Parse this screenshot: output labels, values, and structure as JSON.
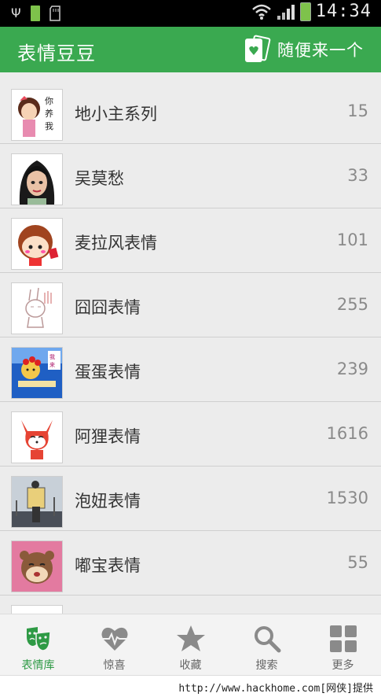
{
  "status_bar": {
    "time": "14:34",
    "icons": [
      "usb-icon",
      "battery-small-icon",
      "sd-card-icon",
      "wifi-icon",
      "signal-icon",
      "battery-icon"
    ]
  },
  "app_bar": {
    "title": "表情豆豆",
    "random_button_label": "随便来一个",
    "random_button_icon": "cards-heart-icon",
    "background_color": "#3aa950"
  },
  "list": {
    "items": [
      {
        "name": "地小主系列",
        "count": "15",
        "thumb": "cartoon-girl-thumb"
      },
      {
        "name": "吴莫愁",
        "count": "33",
        "thumb": "woman-portrait-thumb"
      },
      {
        "name": "麦拉风表情",
        "count": "101",
        "thumb": "round-girl-thumb"
      },
      {
        "name": "囧囧表情",
        "count": "255",
        "thumb": "rabbit-sketch-thumb"
      },
      {
        "name": "蛋蛋表情",
        "count": "239",
        "thumb": "egg-kid-thumb"
      },
      {
        "name": "阿狸表情",
        "count": "1616",
        "thumb": "ali-fox-thumb"
      },
      {
        "name": "泡妞表情",
        "count": "1530",
        "thumb": "crowd-sign-thumb"
      },
      {
        "name": "嘟宝表情",
        "count": "55",
        "thumb": "squirrel-thumb"
      }
    ]
  },
  "bottom_nav": {
    "items": [
      {
        "label": "表情库",
        "icon": "mask-icon",
        "active": true
      },
      {
        "label": "惊喜",
        "icon": "heart-pulse-icon",
        "active": false
      },
      {
        "label": "收藏",
        "icon": "star-icon",
        "active": false
      },
      {
        "label": "搜索",
        "icon": "search-icon",
        "active": false
      },
      {
        "label": "更多",
        "icon": "grid-icon",
        "active": false
      }
    ],
    "active_color": "#2e9a45",
    "inactive_color": "#8a8a8a"
  },
  "footer": {
    "watermark": "http://www.hackhome.com[网侠]提供"
  }
}
